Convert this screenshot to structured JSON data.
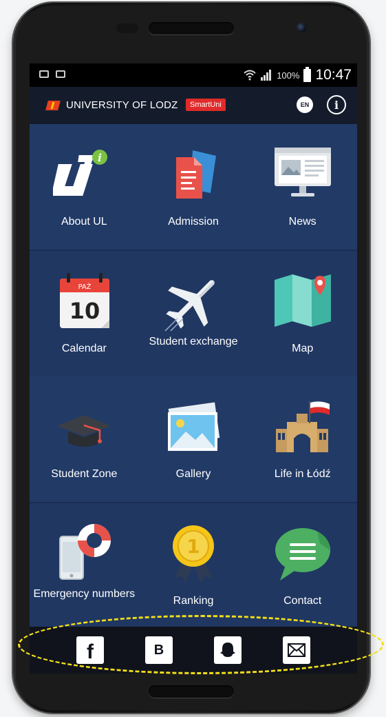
{
  "status": {
    "battery": "100%",
    "time": "10:47"
  },
  "header": {
    "title": "UNIVERSITY OF LODZ",
    "badge": "SmartUni",
    "lang": "EN",
    "info": "i"
  },
  "tiles": [
    {
      "label": "About UL",
      "icon": "about-ul-icon"
    },
    {
      "label": "Admission",
      "icon": "admission-icon"
    },
    {
      "label": "News",
      "icon": "news-icon"
    },
    {
      "label": "Calendar",
      "icon": "calendar-icon",
      "month": "PAŹ",
      "day": "10"
    },
    {
      "label": "Student exchange",
      "icon": "airplane-icon"
    },
    {
      "label": "Map",
      "icon": "map-icon"
    },
    {
      "label": "Student Zone",
      "icon": "graduation-cap-icon"
    },
    {
      "label": "Gallery",
      "icon": "gallery-icon"
    },
    {
      "label": "Life in Łódź",
      "icon": "city-icon"
    },
    {
      "label": "Emergency numbers",
      "icon": "emergency-icon"
    },
    {
      "label": "Ranking",
      "icon": "medal-icon",
      "medal": "1"
    },
    {
      "label": "Contact",
      "icon": "chat-icon"
    }
  ],
  "social": {
    "facebook": "f",
    "blog": "B",
    "snapchat": "snapchat-icon",
    "email": "mail-icon"
  },
  "colors": {
    "screen_bg": "#233a66",
    "header_bg": "#141c2c",
    "badge": "#e12a2a",
    "highlight": "#f2df18"
  }
}
